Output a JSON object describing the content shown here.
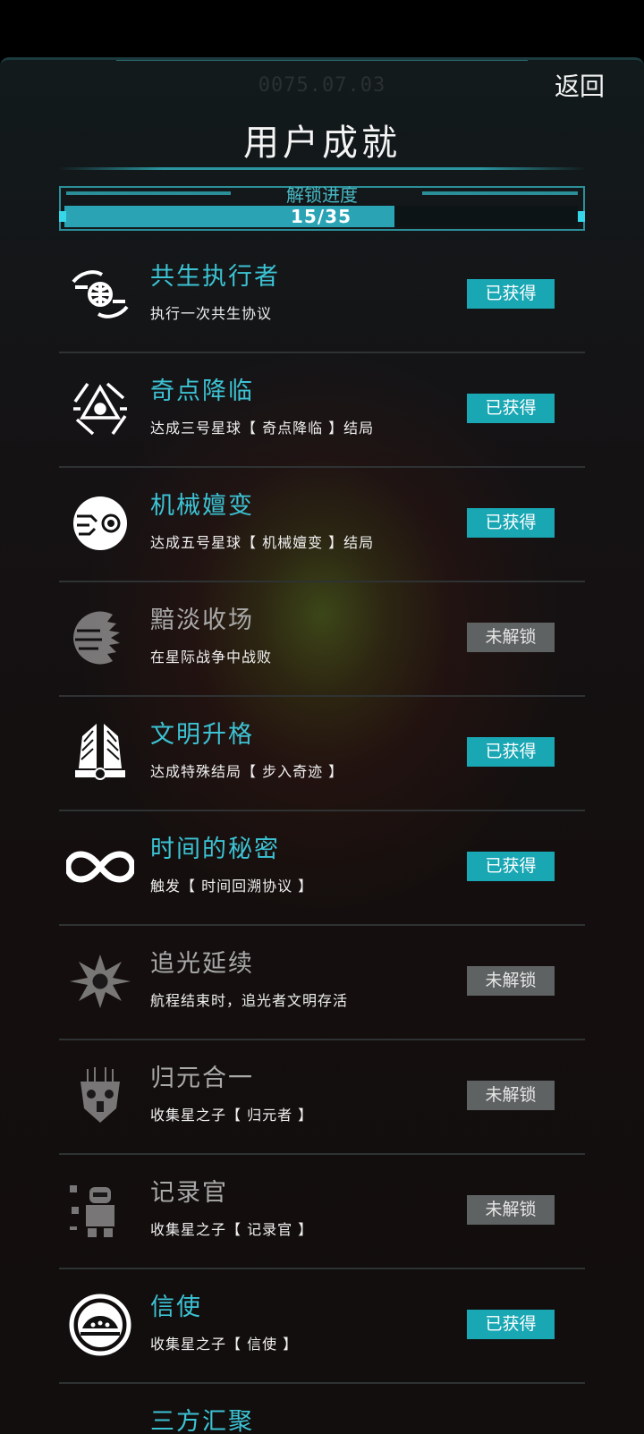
{
  "header": {
    "date": "0075.07.03",
    "back_label": "返回",
    "title": "用户成就"
  },
  "progress": {
    "label": "解锁进度",
    "text": "15/35",
    "unlocked": 15,
    "total": 35
  },
  "colors": {
    "accent": "#3cc3d4",
    "badge_unlocked": "#19a7b4",
    "badge_locked": "#5f6263"
  },
  "achievements": [
    {
      "title": "共生执行者",
      "desc": "执行一次共生协议",
      "status": "已获得",
      "unlocked": true,
      "icon": "hands-globe-icon"
    },
    {
      "title": "奇点降临",
      "desc": "达成三号星球【 奇点降临 】结局",
      "status": "已获得",
      "unlocked": true,
      "icon": "triangle-eye-icon"
    },
    {
      "title": "机械嬗变",
      "desc": "达成五号星球【 机械嬗变 】结局",
      "status": "已获得",
      "unlocked": true,
      "icon": "circuit-eye-icon"
    },
    {
      "title": "黯淡收场",
      "desc": "在星际战争中战败",
      "status": "未解锁",
      "unlocked": false,
      "icon": "shattered-planet-icon"
    },
    {
      "title": "文明升格",
      "desc": "达成特殊结局【 步入奇迹 】",
      "status": "已获得",
      "unlocked": true,
      "icon": "winged-emblem-icon"
    },
    {
      "title": "时间的秘密",
      "desc": "触发【 时间回溯协议 】",
      "status": "已获得",
      "unlocked": true,
      "icon": "infinity-icon"
    },
    {
      "title": "追光延续",
      "desc": "航程结束时，追光者文明存活",
      "status": "未解锁",
      "unlocked": false,
      "icon": "radiant-sun-icon"
    },
    {
      "title": "归元合一",
      "desc": "收集星之子【 归元者 】",
      "status": "未解锁",
      "unlocked": false,
      "icon": "mask-icon"
    },
    {
      "title": "记录官",
      "desc": "收集星之子【 记录官 】",
      "status": "未解锁",
      "unlocked": false,
      "icon": "robot-icon"
    },
    {
      "title": "信使",
      "desc": "收集星之子【 信使 】",
      "status": "已获得",
      "unlocked": true,
      "icon": "messenger-ship-icon"
    },
    {
      "title": "三方汇聚",
      "desc": "",
      "status": "",
      "unlocked": true,
      "icon": "convergence-icon"
    }
  ]
}
